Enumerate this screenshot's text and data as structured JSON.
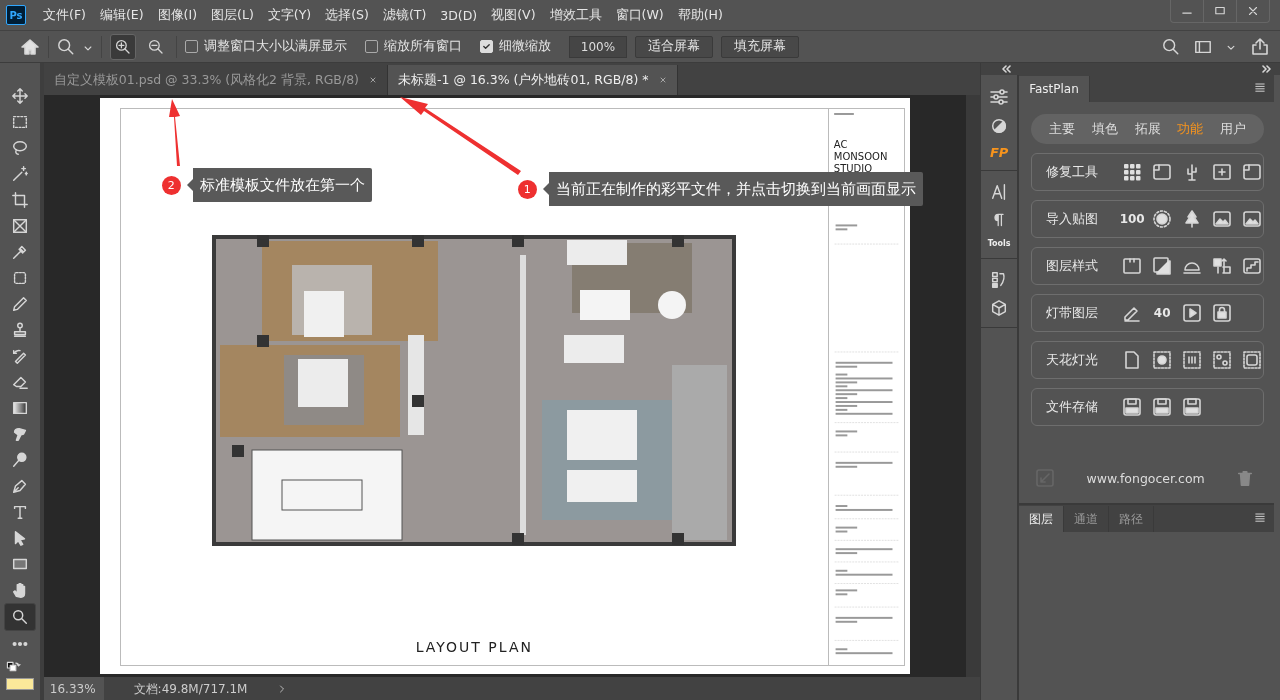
{
  "app_logo": "Ps",
  "menu": [
    "文件(F)",
    "编辑(E)",
    "图像(I)",
    "图层(L)",
    "文字(Y)",
    "选择(S)",
    "滤镜(T)",
    "3D(D)",
    "视图(V)",
    "增效工具",
    "窗口(W)",
    "帮助(H)"
  ],
  "options_bar": {
    "checkboxes": [
      {
        "label": "调整窗口大小以满屏显示",
        "checked": false
      },
      {
        "label": "缩放所有窗口",
        "checked": false
      },
      {
        "label": "细微缩放",
        "checked": true
      }
    ],
    "zoom_value": "100%",
    "buttons": [
      "适合屏幕",
      "填充屏幕"
    ]
  },
  "tools": [
    {
      "selected": false
    },
    {
      "selected": false
    },
    {
      "selected": false
    },
    {
      "selected": false
    },
    {
      "selected": false
    },
    {
      "selected": false
    },
    {
      "selected": false
    },
    {
      "selected": false
    },
    {
      "selected": false
    },
    {
      "selected": false
    },
    {
      "selected": false
    },
    {
      "selected": false
    },
    {
      "selected": false
    },
    {
      "selected": false
    },
    {
      "selected": false
    },
    {
      "selected": false
    },
    {
      "selected": false
    },
    {
      "selected": false
    },
    {
      "selected": false
    },
    {
      "selected": false
    },
    {
      "selected": true
    }
  ],
  "doc_tabs": [
    {
      "label": "自定义模板01.psd @ 33.3% (风格化2 背景, RGB/8)",
      "selected": false
    },
    {
      "label": "未标题-1 @ 16.3% (户外地砖01, RGB/8) *",
      "selected": true
    }
  ],
  "document": {
    "studio_name": [
      "AC",
      "MONSOON",
      "STUDIO"
    ],
    "plan_title": "LAYOUT PLAN"
  },
  "callouts": [
    {
      "number": "2",
      "text": "标准模板文件放在第一个"
    },
    {
      "number": "1",
      "text": "当前正在制作的彩平文件，并点击切换到当前画面显示"
    }
  ],
  "status_bar": {
    "zoom": "16.33%",
    "doc_size": "文档:49.8M/717.1M"
  },
  "side_strip": {
    "logo": "FP",
    "tools_label": "Tools"
  },
  "fastplan": {
    "title": "FastPlan",
    "tabs": [
      {
        "label": "主要",
        "selected": false
      },
      {
        "label": "填色",
        "selected": false
      },
      {
        "label": "拓展",
        "selected": false
      },
      {
        "label": "功能",
        "selected": true
      },
      {
        "label": "用户",
        "selected": false
      }
    ],
    "rows": [
      {
        "label": "修复工具",
        "items": [
          {
            "kind": "icon"
          },
          {
            "kind": "icon"
          },
          {
            "kind": "icon"
          },
          {
            "kind": "icon"
          },
          {
            "kind": "icon"
          }
        ]
      },
      {
        "label": "导入贴图",
        "items": [
          {
            "kind": "value",
            "text": "100"
          },
          {
            "kind": "icon"
          },
          {
            "kind": "icon"
          },
          {
            "kind": "icon"
          },
          {
            "kind": "icon"
          }
        ]
      },
      {
        "label": "图层样式",
        "items": [
          {
            "kind": "icon"
          },
          {
            "kind": "icon"
          },
          {
            "kind": "icon"
          },
          {
            "kind": "icon"
          },
          {
            "kind": "icon"
          }
        ]
      },
      {
        "label": "灯带图层",
        "items": [
          {
            "kind": "icon"
          },
          {
            "kind": "value",
            "text": "40"
          },
          {
            "kind": "icon"
          },
          {
            "kind": "icon"
          }
        ]
      },
      {
        "label": "天花灯光",
        "items": [
          {
            "kind": "icon"
          },
          {
            "kind": "icon"
          },
          {
            "kind": "icon"
          },
          {
            "kind": "icon"
          },
          {
            "kind": "icon"
          }
        ]
      },
      {
        "label": "文件存储",
        "items": [
          {
            "kind": "icon"
          },
          {
            "kind": "icon"
          },
          {
            "kind": "icon"
          }
        ]
      }
    ],
    "website": "www.fongocer.com"
  },
  "layers_panel": {
    "tabs": [
      {
        "label": "图层",
        "selected": true
      },
      {
        "label": "通道",
        "selected": false
      },
      {
        "label": "路径",
        "selected": false
      }
    ]
  }
}
